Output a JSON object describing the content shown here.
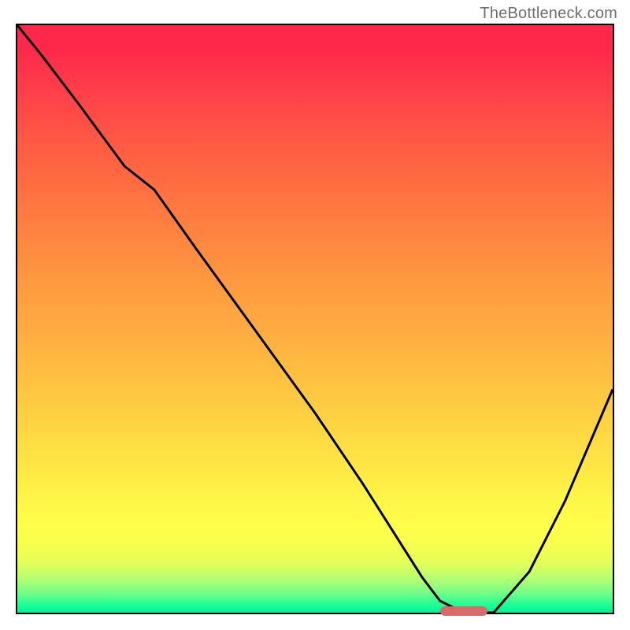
{
  "watermark": "TheBottleneck.com",
  "colors": {
    "frame_border": "#000000",
    "curve_stroke": "#000000",
    "marker_fill": "#d96a6a",
    "gradient_top": "#fe294a",
    "gradient_bottom": "#00f094"
  },
  "chart_data": {
    "type": "line",
    "title": "",
    "xlabel": "",
    "ylabel": "",
    "xlim": [
      0,
      100
    ],
    "ylim": [
      0,
      100
    ],
    "x": [
      0,
      4,
      10,
      18,
      23,
      30,
      40,
      50,
      58,
      63,
      68,
      71,
      75,
      80,
      86,
      92,
      100
    ],
    "values": [
      100,
      95,
      87,
      76,
      72,
      62,
      48,
      34,
      22,
      14,
      6,
      2,
      0,
      0,
      7,
      19,
      38
    ],
    "marker": {
      "x_start": 71,
      "x_end": 79,
      "y": 0
    },
    "annotations": []
  }
}
